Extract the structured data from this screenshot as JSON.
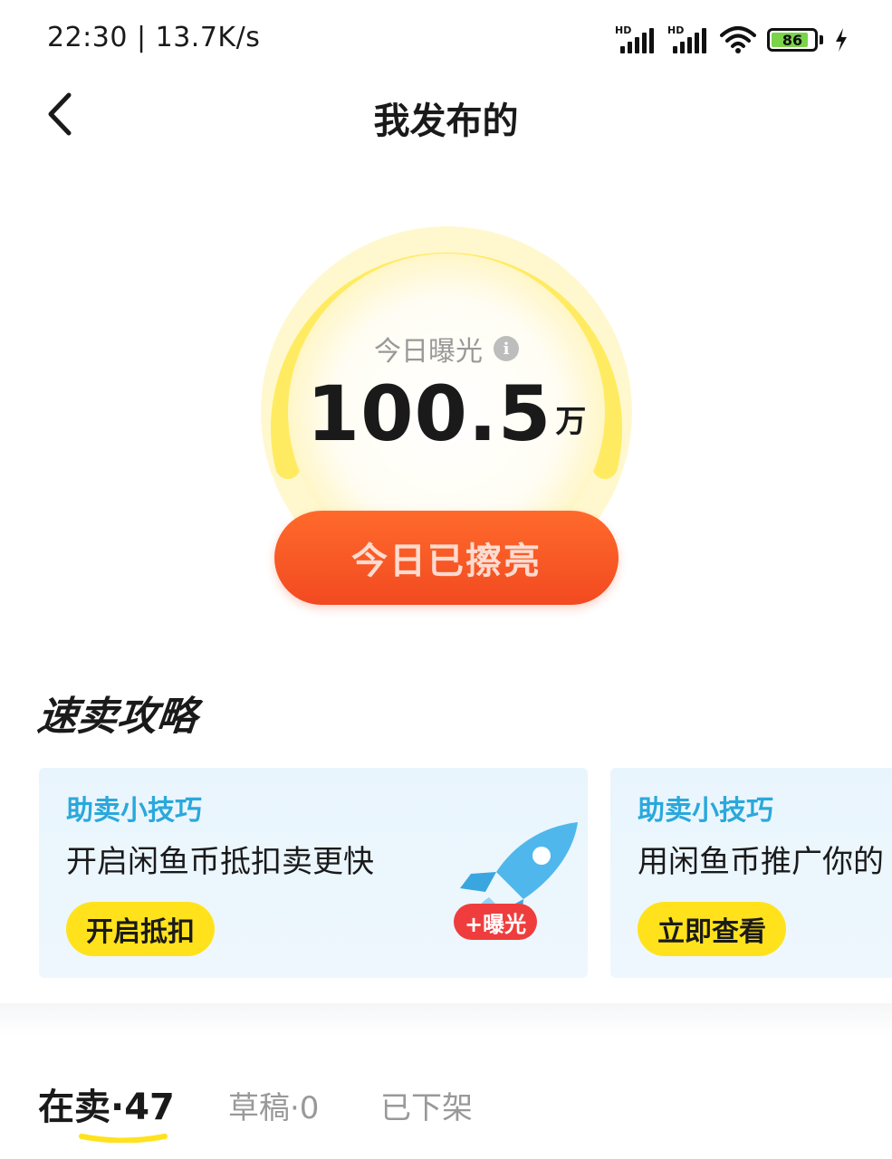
{
  "status_bar": {
    "time_speed": "22:30 | 13.7K/s",
    "signal_label_1": "HD",
    "signal_label_2": "HD",
    "battery_level": "86",
    "icons": [
      "signal-icon",
      "signal-icon",
      "wifi-icon",
      "battery-icon",
      "charging-icon"
    ]
  },
  "nav": {
    "back_icon": "chevron-left-icon",
    "title": "我发布的"
  },
  "exposure": {
    "label": "今日曝光",
    "info_glyph": "i",
    "value": "100.5",
    "unit": "万",
    "button_label": "今日已擦亮"
  },
  "section": {
    "title": "速卖攻略"
  },
  "tips": [
    {
      "tag": "助卖小技巧",
      "text": "开启闲鱼币抵扣卖更快",
      "button": "开启抵扣",
      "badge": "+曝光",
      "icon": "rocket-icon"
    },
    {
      "tag": "助卖小技巧",
      "text": "用闲鱼币推广你的",
      "button": "立即查看"
    }
  ],
  "tabs": [
    {
      "label": "在卖·47",
      "active": true
    },
    {
      "label": "草稿·0",
      "active": false
    },
    {
      "label": "已下架",
      "active": false
    }
  ],
  "colors": {
    "accent_yellow": "#ffe21c",
    "button_orange": "#f24a21",
    "tip_blue": "#2aa8dc",
    "badge_red": "#ef3d3d"
  }
}
